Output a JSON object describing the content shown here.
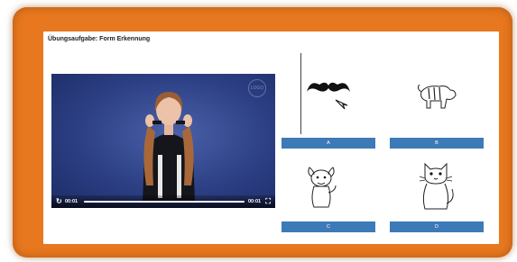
{
  "task": {
    "title": "Übungsaufgabe: Form Erkennung"
  },
  "video": {
    "current_time": "00:01",
    "duration": "00:01",
    "progress": 1.0,
    "watermark": "LOGO"
  },
  "options": [
    {
      "label": "A",
      "image": "mustache-icon"
    },
    {
      "label": "B",
      "image": "tiger-icon"
    },
    {
      "label": "C",
      "image": "dog-icon"
    },
    {
      "label": "D",
      "image": "cat-icon"
    }
  ],
  "colors": {
    "frame": "#e8781f",
    "button": "#3d7ab8",
    "video_bg": "#2c3f84"
  }
}
